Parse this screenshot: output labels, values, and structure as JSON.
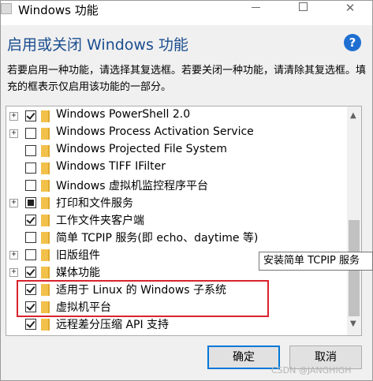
{
  "window": {
    "title": "Windows 功能",
    "min_glyph": "—",
    "close_glyph": "✕"
  },
  "header": {
    "heading": "启用或关闭 Windows 功能",
    "help_glyph": "?",
    "description": "若要启用一种功能，请选择其复选框。若要关闭一种功能，请清除其复选框。填充的框表示仅启用该功能的一部分。"
  },
  "features": [
    {
      "label": "Windows PowerShell 2.0",
      "expandable": true,
      "state": "checked"
    },
    {
      "label": "Windows Process Activation Service",
      "expandable": true,
      "state": "unchecked"
    },
    {
      "label": "Windows Projected File System",
      "expandable": false,
      "state": "unchecked"
    },
    {
      "label": "Windows TIFF IFilter",
      "expandable": false,
      "state": "unchecked"
    },
    {
      "label": "Windows 虚拟机监控程序平台",
      "expandable": false,
      "state": "unchecked"
    },
    {
      "label": "打印和文件服务",
      "expandable": true,
      "state": "partial"
    },
    {
      "label": "工作文件夹客户端",
      "expandable": false,
      "state": "checked"
    },
    {
      "label": "简单 TCPIP 服务(即 echo、daytime 等)",
      "expandable": false,
      "state": "unchecked"
    },
    {
      "label": "旧版组件",
      "expandable": true,
      "state": "unchecked"
    },
    {
      "label": "媒体功能",
      "expandable": true,
      "state": "checked"
    },
    {
      "label": "适用于 Linux 的 Windows 子系统",
      "expandable": false,
      "state": "checked"
    },
    {
      "label": "虚拟机平台",
      "expandable": false,
      "state": "checked"
    },
    {
      "label": "远程差分压缩 API 支持",
      "expandable": false,
      "state": "checked"
    }
  ],
  "tooltip": "安装简单 TCPIP 服务",
  "buttons": {
    "ok": "确定",
    "cancel": "取消"
  },
  "watermark": "CSDN @JANGHIGH",
  "colors": {
    "heading": "#1a4d8f",
    "highlight_box": "#d9232d",
    "default_button_border": "#0078d7",
    "folder": "#f2c14b"
  }
}
